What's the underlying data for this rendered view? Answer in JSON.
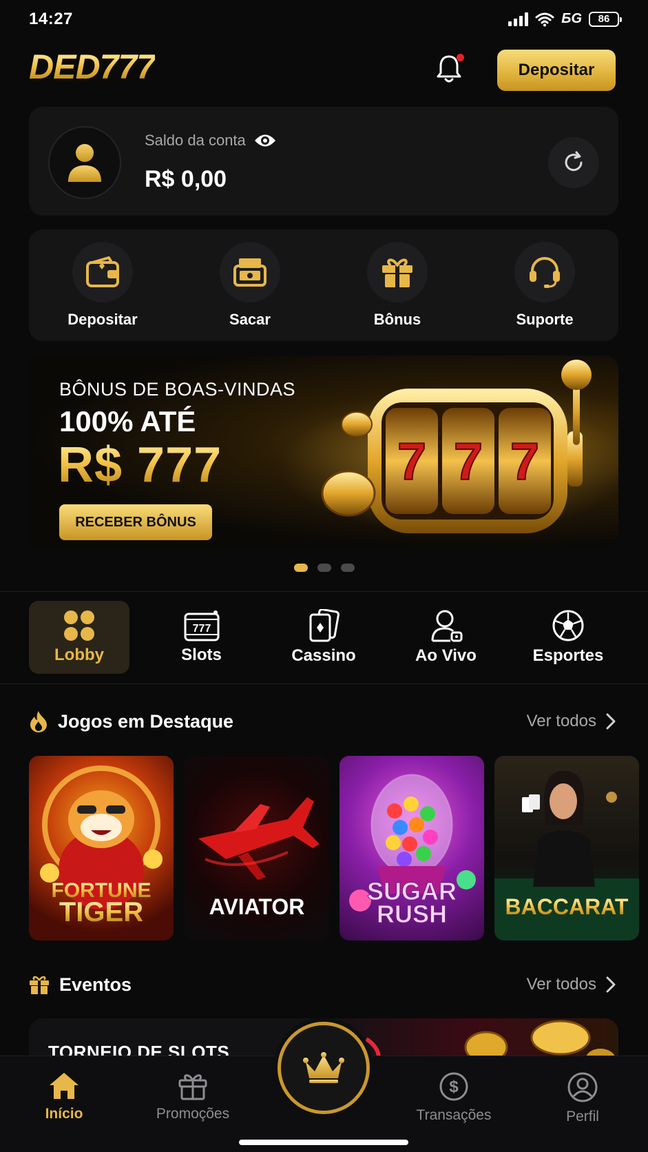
{
  "status_bar": {
    "time": "14:27",
    "network": "БG",
    "battery": "86"
  },
  "header": {
    "logo": "DED777",
    "deposit_label": "Depositar"
  },
  "balance": {
    "label": "Saldo da conta",
    "value": "R$ 0,00"
  },
  "actions": [
    {
      "label": "Depositar",
      "icon": "wallet-icon"
    },
    {
      "label": "Sacar",
      "icon": "cash-withdraw-icon"
    },
    {
      "label": "Bônus",
      "icon": "gift-icon"
    },
    {
      "label": "Suporte",
      "icon": "headset-icon"
    }
  ],
  "banner": {
    "subtitle": "BÔNUS DE BOAS-VINDAS",
    "line1": "100% ATÉ",
    "amount": "R$ 777",
    "button": "RECEBER BÔNUS",
    "slides": 3,
    "active_slide": 1
  },
  "categories": [
    {
      "label": "Lobby",
      "icon": "grid-icon",
      "active": true
    },
    {
      "label": "Slots",
      "icon": "slot-777-icon",
      "active": false
    },
    {
      "label": "Cassino",
      "icon": "card-icon",
      "active": false
    },
    {
      "label": "Ao Vivo",
      "icon": "live-dealer-icon",
      "active": false
    },
    {
      "label": "Esportes",
      "icon": "soccer-ball-icon",
      "active": false
    }
  ],
  "featured": {
    "title": "Jogos em Destaque",
    "see_all": "Ver todos",
    "games": [
      {
        "line1": "FORTUNE",
        "line2": "TIGER"
      },
      {
        "line1": "AVIATOR",
        "line2": ""
      },
      {
        "line1": "SUGAR",
        "line2": "RUSH"
      },
      {
        "line1": "BACCARAT",
        "line2": ""
      }
    ]
  },
  "events": {
    "title": "Eventos",
    "see_all": "Ver todos",
    "card_title": "TORNEIO DE SLOTS"
  },
  "nav": {
    "items": [
      {
        "label": "Início",
        "active": true
      },
      {
        "label": "Promoções",
        "active": false
      },
      {
        "label": "Transações",
        "active": false
      },
      {
        "label": "Perfil",
        "active": false
      }
    ]
  },
  "colors": {
    "accent": "#E7B74A",
    "background": "#0A0A0B",
    "card": "#151516",
    "notification": "#E8202A"
  }
}
